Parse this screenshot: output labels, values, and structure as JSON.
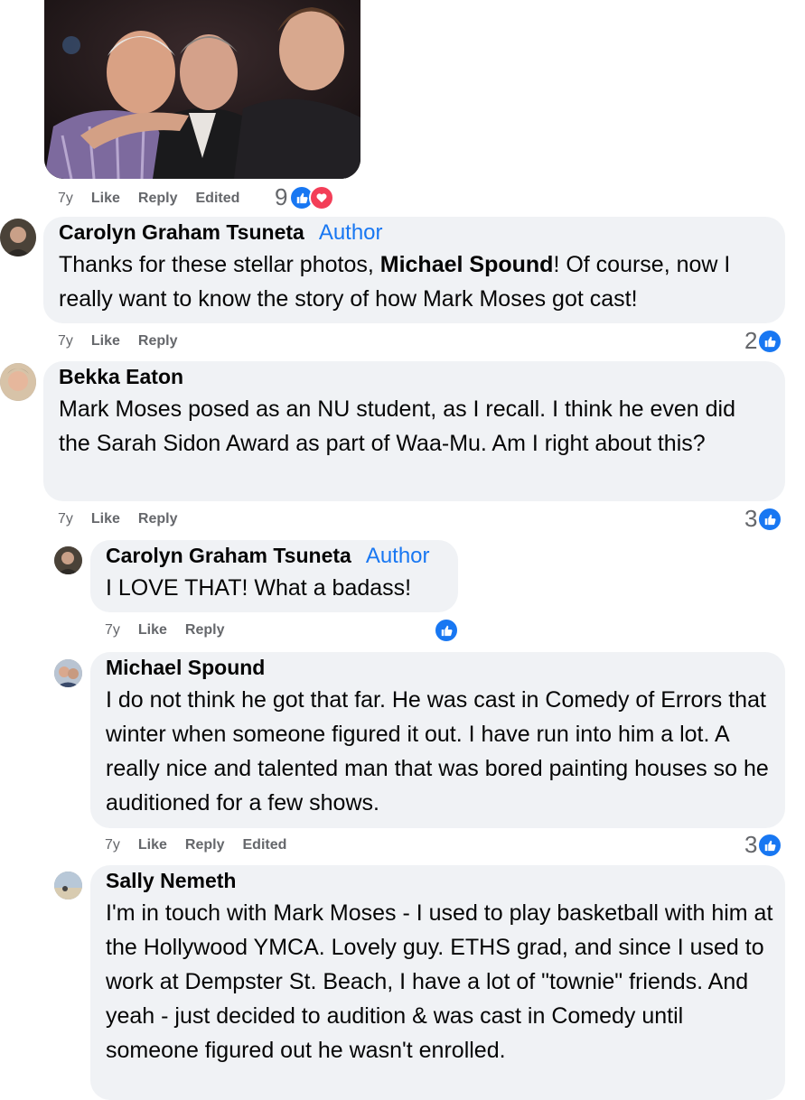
{
  "comments": [
    {
      "meta": {
        "time": "7y",
        "like": "Like",
        "reply": "Reply",
        "edited": "Edited"
      },
      "reactions": {
        "count": "9",
        "types": [
          "like",
          "love"
        ]
      }
    },
    {
      "author": "Carolyn Graham Tsuneta",
      "badge": "Author",
      "text_before": "Thanks for these stellar photos, ",
      "mention": "Michael Spound",
      "text_after": "! Of course, now I really want to know the story of how Mark Moses got cast!",
      "meta": {
        "time": "7y",
        "like": "Like",
        "reply": "Reply"
      },
      "reactions": {
        "count": "2",
        "types": [
          "like"
        ]
      }
    },
    {
      "author": "Bekka Eaton",
      "text": "Mark Moses posed as an NU student, as I recall. I think he even did the Sarah Sidon Award as part of Waa-Mu. Am I right about this?",
      "meta": {
        "time": "7y",
        "like": "Like",
        "reply": "Reply"
      },
      "reactions": {
        "count": "3",
        "types": [
          "like"
        ]
      }
    },
    {
      "author": "Carolyn Graham Tsuneta",
      "badge": "Author",
      "text": "I LOVE THAT! What a badass!",
      "meta": {
        "time": "7y",
        "like": "Like",
        "reply": "Reply"
      },
      "reactions": {
        "count": "",
        "types": [
          "like"
        ]
      }
    },
    {
      "author": "Michael Spound",
      "text": "I do not think he got that far. He was cast in Comedy of Errors that winter when someone figured it out. I have run into him a lot. A really nice and talented man that was bored painting houses so he auditioned for a few shows.",
      "meta": {
        "time": "7y",
        "like": "Like",
        "reply": "Reply",
        "edited": "Edited"
      },
      "reactions": {
        "count": "3",
        "types": [
          "like"
        ]
      }
    },
    {
      "author": "Sally Nemeth",
      "text": "I'm in touch with Mark Moses - I used to play basketball with him at the Hollywood YMCA. Lovely guy. ETHS grad, and since I used to work at Dempster St. Beach, I have a lot of \"townie\" friends. And yeah - just decided to audition & was cast in Comedy until someone figured out he wasn't enrolled."
    }
  ],
  "colors": {
    "accent": "#1877f2",
    "love": "#f33e58",
    "bubble": "#f0f2f5",
    "meta": "#65676b"
  }
}
